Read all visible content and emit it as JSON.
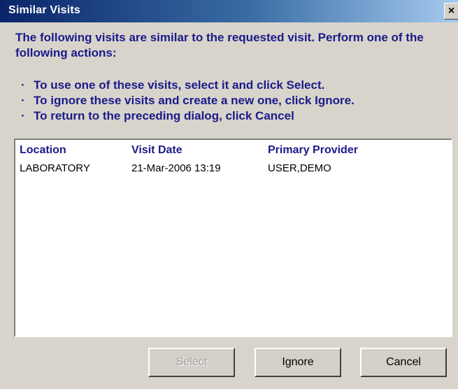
{
  "window": {
    "title": "Similar Visits",
    "close_glyph": "×"
  },
  "intro_text": "The following visits are similar to the requested visit.  Perform one of the following actions:",
  "instructions": [
    "To use one of these visits, select it and click Select.",
    "To ignore these visits and create a new one, click Ignore.",
    "To return to the preceding dialog, click Cancel"
  ],
  "table": {
    "columns": [
      "Location",
      "Visit Date",
      "Primary Provider"
    ],
    "rows": [
      {
        "location": "LABORATORY",
        "visit_date": "21-Mar-2006 13:19",
        "primary_provider": "USER,DEMO"
      }
    ]
  },
  "buttons": {
    "select": {
      "label": "Select",
      "enabled": false
    },
    "ignore": {
      "label": "Ignore",
      "enabled": true
    },
    "cancel": {
      "label": "Cancel",
      "enabled": true
    }
  },
  "colors": {
    "instruction_text": "#1a1a8a",
    "title_bar": "#0a246a",
    "dialog_background": "#d8d4cc"
  }
}
